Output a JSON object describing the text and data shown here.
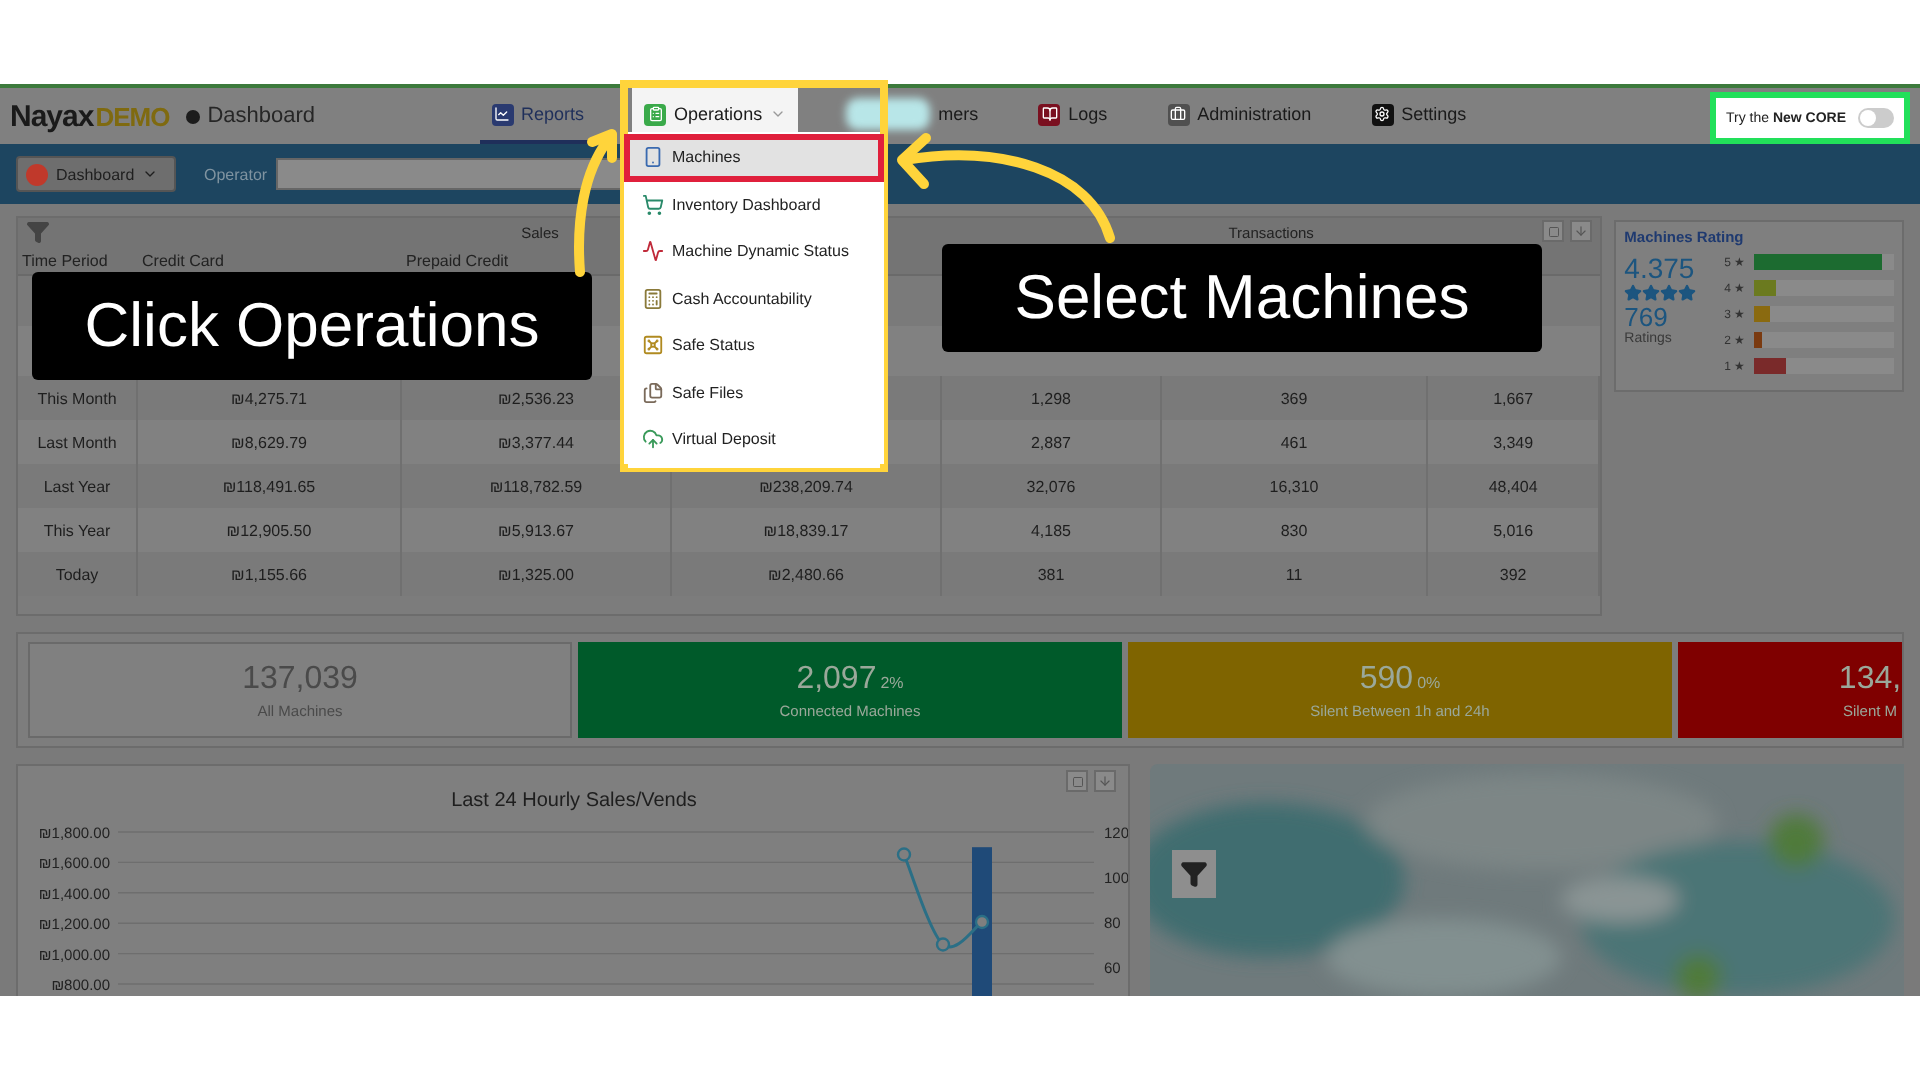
{
  "header": {
    "logo": {
      "brand": "Nayax",
      "suffix": "DEMO"
    },
    "page_title": "Dashboard",
    "nav": [
      {
        "kind": "reports",
        "label": "Reports",
        "selected": true,
        "expanded": false
      },
      {
        "kind": "operations",
        "label": "Operations",
        "selected": false,
        "expanded": true
      },
      {
        "kind": "blurred",
        "label": "mers",
        "selected": false,
        "expanded": false
      },
      {
        "kind": "logs",
        "label": "Logs",
        "selected": false,
        "expanded": false
      },
      {
        "kind": "admin",
        "label": "Administration",
        "selected": false,
        "expanded": false
      },
      {
        "kind": "settings",
        "label": "Settings",
        "selected": false,
        "expanded": false
      }
    ],
    "core_toggle": {
      "label": "Try the **New CORE**",
      "on": false
    }
  },
  "toolbar": {
    "view": "Dashboard",
    "operator_label": "Operator"
  },
  "operations_menu": [
    {
      "kind": "machines",
      "label": "Machines",
      "selected": true
    },
    {
      "kind": "inventory",
      "label": "Inventory Dashboard",
      "selected": false
    },
    {
      "kind": "dynamic",
      "label": "Machine Dynamic Status",
      "selected": false
    },
    {
      "kind": "cash",
      "label": "Cash Accountability",
      "selected": false
    },
    {
      "kind": "safe",
      "label": "Safe Status",
      "selected": false
    },
    {
      "kind": "files",
      "label": "Safe Files",
      "selected": false
    },
    {
      "kind": "deposit",
      "label": "Virtual Deposit",
      "selected": false
    }
  ],
  "sales_table": {
    "groups": [
      "Sales",
      "Transactions"
    ],
    "columns": [
      "Time Period",
      "Credit Card",
      "Prepaid Credit"
    ],
    "rows": [
      {
        "period": "This Month",
        "cells": [
          "₪4,275.71",
          "₪2,536.23",
          null,
          "1,298",
          "369",
          "1,667"
        ]
      },
      {
        "period": "Last Month",
        "cells": [
          "₪8,629.79",
          "₪3,377.44",
          null,
          "2,887",
          "461",
          "3,349"
        ]
      },
      {
        "period": "Last Year",
        "cells": [
          "₪118,491.65",
          "₪118,782.59",
          "₪238,209.74",
          "32,076",
          "16,310",
          "48,404"
        ]
      },
      {
        "period": "This Year",
        "cells": [
          "₪12,905.50",
          "₪5,913.67",
          "₪18,839.17",
          "4,185",
          "830",
          "5,016"
        ]
      },
      {
        "period": "Today",
        "cells": [
          "₪1,155.66",
          "₪1,325.00",
          "₪2,480.66",
          "381",
          "11",
          "392"
        ]
      }
    ]
  },
  "machines_rating": {
    "title": "Machines Rating",
    "score": "4.375",
    "stars": 4,
    "count": "769",
    "count_label": "Ratings",
    "bars": [
      {
        "label": "5 ★",
        "level": 0.92,
        "color": "#1c6b30"
      },
      {
        "label": "4 ★",
        "level": 0.15,
        "color": "#6b7a1f"
      },
      {
        "label": "3 ★",
        "level": 0.11,
        "color": "#8a6a10"
      },
      {
        "label": "2 ★",
        "level": 0.05,
        "color": "#7a3a10"
      },
      {
        "label": "1 ★",
        "level": 0.23,
        "color": "#7a2a2a"
      }
    ]
  },
  "machine_status": [
    {
      "value": "137,039",
      "label": "All Machines",
      "color": "#808080"
    },
    {
      "value": "2,097",
      "percent": "2%",
      "label": "Connected Machines",
      "color": "#005a2a"
    },
    {
      "value": "590",
      "percent": "0%",
      "label": "Silent Between 1h and 24h",
      "color": "#7f6400"
    },
    {
      "value": "134,",
      "label": "Silent M",
      "color": "#7f0000"
    }
  ],
  "hourly_chart": {
    "chart_data": {
      "type": "bar",
      "title": "Last 24 Hourly Sales/Vends",
      "yticks": [
        {
          "value": 800,
          "label": "₪800.00"
        },
        {
          "value": 1000,
          "label": "₪1,000.00"
        },
        {
          "value": 1200,
          "label": "₪1,200.00"
        },
        {
          "value": 1400,
          "label": "₪1,400.00"
        },
        {
          "value": 1600,
          "label": "₪1,600.00"
        },
        {
          "value": 1800,
          "label": "₪1,800.00"
        }
      ],
      "ylim": [
        800,
        1800
      ],
      "y2ticks": [
        60,
        80,
        100,
        120
      ],
      "y2lim": [
        60,
        120
      ],
      "grid": true,
      "series": [
        {
          "type": "bar",
          "color": "#1f4a78",
          "values": [
            null,
            null,
            null,
            null,
            null,
            null,
            null,
            null,
            null,
            null,
            null,
            null,
            null,
            null,
            null,
            null,
            null,
            null,
            null,
            null,
            null,
            1700,
            null,
            null
          ]
        },
        {
          "type": "line",
          "color": "#2b6f86",
          "axis": "y2",
          "marker": "circle",
          "values": [
            null,
            null,
            null,
            null,
            null,
            null,
            null,
            null,
            null,
            null,
            null,
            null,
            null,
            null,
            null,
            null,
            null,
            null,
            null,
            110,
            70,
            80,
            null,
            null
          ]
        }
      ]
    }
  },
  "annotations": [
    {
      "text": "Click Operations"
    },
    {
      "text": "Select Machines"
    }
  ]
}
